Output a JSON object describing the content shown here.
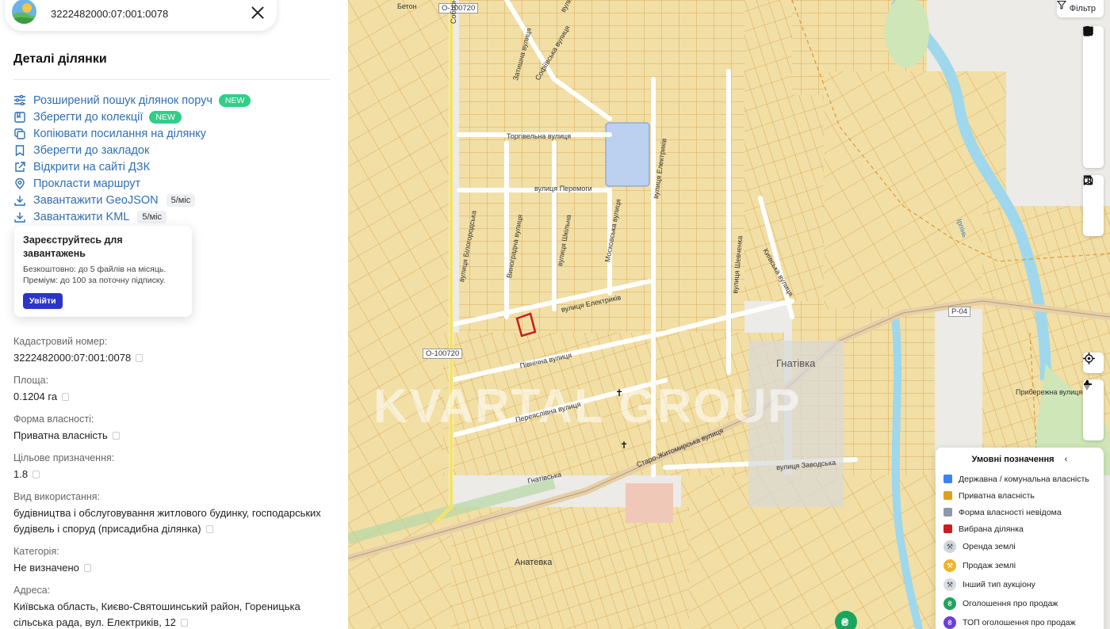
{
  "search": {
    "query": "3222482000:07:001:0078",
    "close_icon": "close-icon"
  },
  "panel": {
    "title": "Деталі ділянки",
    "actions": [
      {
        "label": "Розширений пошук ділянок поруч",
        "icon": "sliders-icon",
        "badge": "NEW"
      },
      {
        "label": "Зберегти до колекції",
        "icon": "collection-icon",
        "badge": "NEW"
      },
      {
        "label": "Копіювати посилання на ділянку",
        "icon": "copy-link-icon"
      },
      {
        "label": "Зберегти до закладок",
        "icon": "bookmark-icon"
      },
      {
        "label": "Відкрити на сайті ДЗК",
        "icon": "external-link-icon"
      },
      {
        "label": "Прокласти маршрут",
        "icon": "location-pin-icon"
      },
      {
        "label": "Завантажити GeoJSON",
        "icon": "download-icon",
        "limit": "5/міс"
      },
      {
        "label": "Завантажити KML",
        "icon": "download-icon",
        "limit": "5/міс"
      }
    ],
    "register": {
      "title": "Зареєструйтесь для завантажень",
      "line1": "Безкоштовно: до 5 файлів на місяць.",
      "line2": "Преміум: до 100 за поточну підписку.",
      "button": "Увійти"
    },
    "details": [
      {
        "label": "Кадастровий номер:",
        "value": "3222482000:07:001:0078"
      },
      {
        "label": "Площа:",
        "value": "0.1204 га"
      },
      {
        "label": "Форма власності:",
        "value": "Приватна власність"
      },
      {
        "label": "Цільове призначення:",
        "value": "1.8"
      },
      {
        "label": "Вид використання:",
        "value": "будівництва і обслуговування житлового будинку, господарських будівель і споруд (присадибна ділянка)"
      },
      {
        "label": "Категорія:",
        "value": "Не визначено"
      },
      {
        "label": "Адреса:",
        "value": "Київська область, Києво-Святошинський район, Гореницька сільська рада, вул. Електриків, 12"
      }
    ]
  },
  "map": {
    "filter_label": "Фільтр",
    "town": "Гнатівка",
    "village2": "Анатевка",
    "watermark": "KVARTAL GROUP",
    "road_tags": [
      "О-100720",
      "О-100720",
      "Р-04"
    ],
    "streets": [
      "Соборна вулиця",
      "вулиця Степова",
      "Торгівельна вулиця",
      "вулиця Перемоги",
      "вулиця Білогородська",
      "Виноградна вулиця",
      "вулиця Шкільна",
      "Московська вулиця",
      "вулиця Електриків",
      "Північна вулиця",
      "Переяслівна вулиця",
      "Старо-Житомирська вулиця",
      "вулиця Заводська",
      "Київська вулиця",
      "вулиця Шевченка",
      "Гнатівська",
      "Ірпінь",
      "Бетон",
      "Затишна вулиця",
      "Софіївська вулиця",
      "вулиця Електриків",
      "Прибережна вулиця"
    ],
    "legend": {
      "title": "Умовні позначення",
      "items": [
        {
          "label": "Державна / комунальна власність",
          "color": "#3b82f6",
          "type": "square"
        },
        {
          "label": "Приватна власність",
          "color": "#e0a020",
          "type": "square"
        },
        {
          "label": "Форма власності невідома",
          "color": "#8d99a8",
          "type": "square"
        },
        {
          "label": "Вибрана ділянка",
          "color": "#c81e1e",
          "type": "square"
        },
        {
          "label": "Оренда землі",
          "color": "#cfd6de",
          "type": "round",
          "icon": "lease-icon"
        },
        {
          "label": "Продаж землі",
          "color": "#f0b429",
          "type": "round",
          "icon": "sale-icon"
        },
        {
          "label": "Інший тип аукціону",
          "color": "#d8dde3",
          "type": "round",
          "icon": "auction-icon"
        },
        {
          "label": "Оголошення про продаж",
          "color": "#1aa55d",
          "type": "round",
          "icon": "hryvnia-icon"
        },
        {
          "label": "ТОП оголошення про продаж",
          "color": "#6b3fd6",
          "type": "round",
          "icon": "top-icon"
        }
      ]
    }
  }
}
